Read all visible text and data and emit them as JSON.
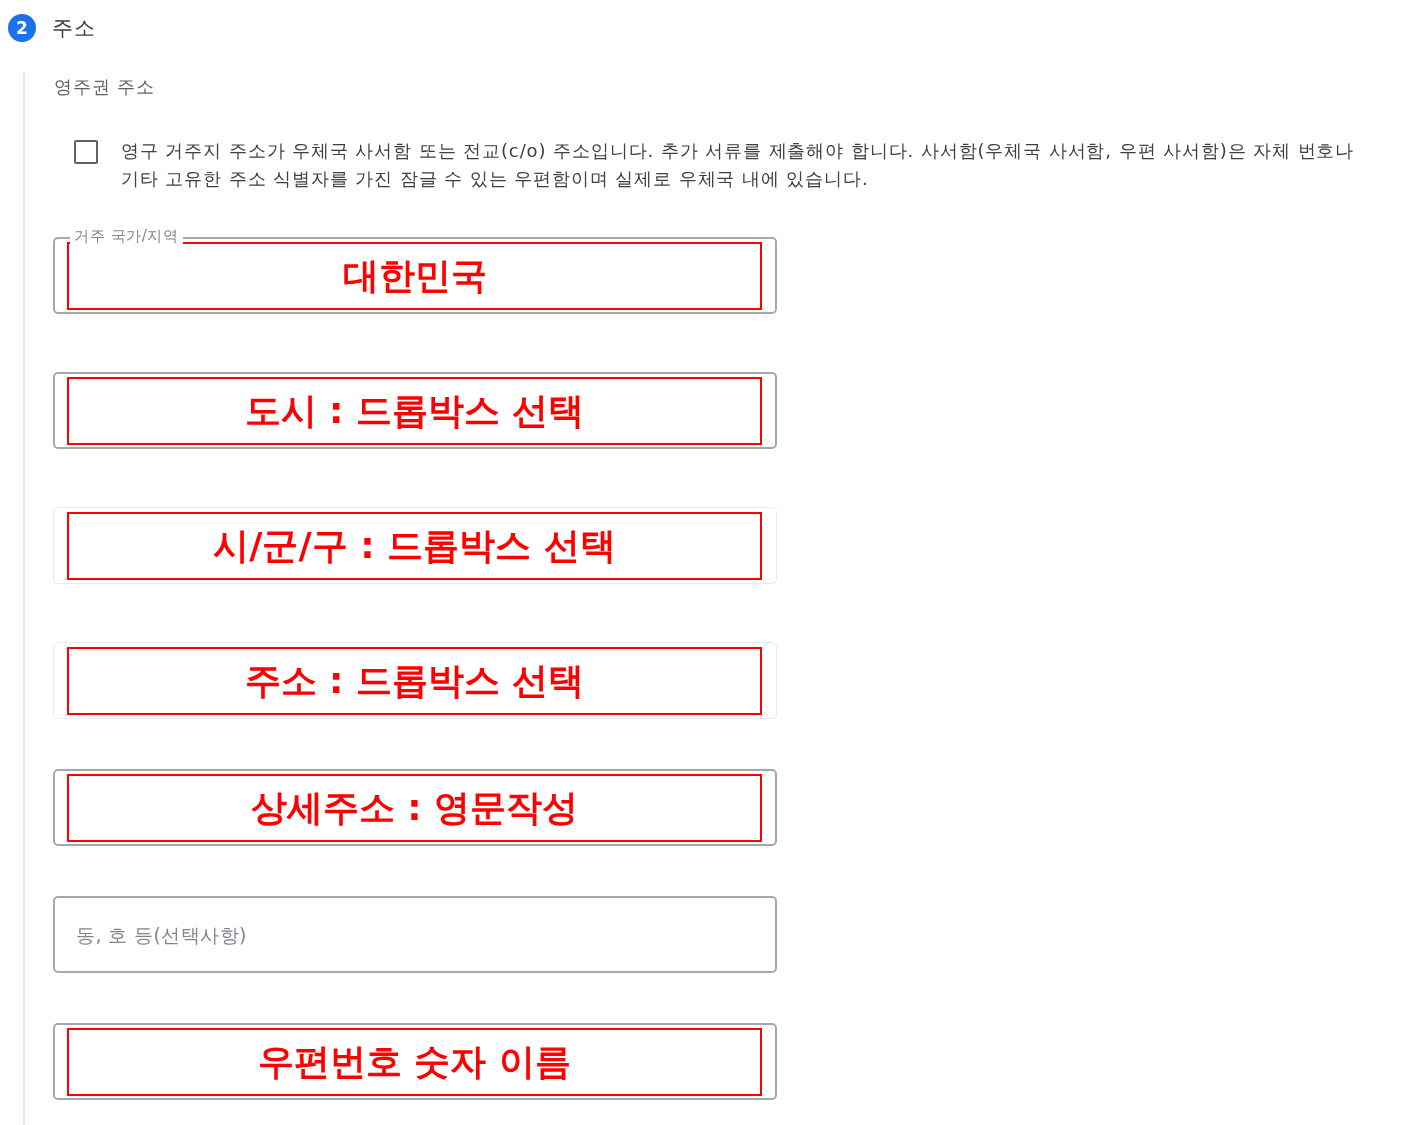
{
  "step": {
    "number": "2",
    "title": "주소"
  },
  "section": {
    "title": "영주권 주소",
    "po_box": {
      "checked": false,
      "label": "영구 거주지 주소가 우체국 사서함 또는 전교(c/o) 주소입니다. 추가 서류를 제출해야 합니다. 사서함(우체국 사서함, 우편 사서함)은 자체 번호나 기타 고유한 주소 식별자를 가진 잠글 수 있는 우편함이며 실제로 우체국 내에 있습니다."
    },
    "fields": [
      {
        "label": "거주 국가/지역",
        "annotation": "대한민국",
        "disabled": false
      },
      {
        "annotation": "도시 : 드롭박스 선택",
        "disabled": false
      },
      {
        "annotation": "시/군/구 : 드롭박스 선택",
        "disabled": true
      },
      {
        "annotation": "주소 : 드롭박스 선택",
        "disabled": true
      },
      {
        "annotation": "상세주소 : 영문작성",
        "disabled": false
      },
      {
        "placeholder": "동, 호 등(선택사항)",
        "disabled": false
      },
      {
        "annotation": "우편번호 숫자 이름",
        "disabled": false
      }
    ]
  }
}
